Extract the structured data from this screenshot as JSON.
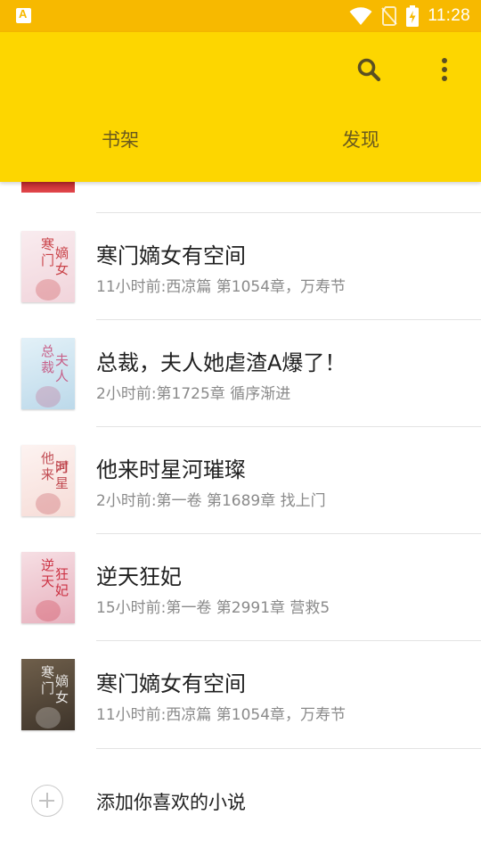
{
  "status_bar": {
    "time": "11:28",
    "icons": [
      "app-notification-icon",
      "wifi-icon",
      "no-sim-icon",
      "battery-charging-icon"
    ],
    "background": "#f7b900"
  },
  "app_bar": {
    "background": "#fdd600",
    "actions": [
      "search-icon",
      "more-vert-icon"
    ],
    "tabs": [
      {
        "label": "书架",
        "selected": true
      },
      {
        "label": "发现",
        "selected": false
      }
    ]
  },
  "books": [
    {
      "title": "寒门嫡女有空间",
      "subtitle": "11小时前:西凉篇 第1054章，万寿节",
      "cover_text": "寒门嫡女",
      "cover": [
        "#f9ecef",
        "#f1d4db"
      ],
      "cover_ink": "#c2272d"
    },
    {
      "title": "总裁，夫人她虐渣A爆了！",
      "subtitle": "2小时前:第1725章 循序渐进",
      "cover_text": "总裁夫人",
      "cover": [
        "#e3f1f8",
        "#bcd9ea"
      ],
      "cover_ink": "#c54a78"
    },
    {
      "title": "他来时星河璀璨",
      "subtitle": "2小时前:第一卷 第1689章 找上门",
      "cover_text": "他来时星河",
      "cover": [
        "#fdf3f1",
        "#f6dcd7"
      ],
      "cover_ink": "#b8313a"
    },
    {
      "title": "逆天狂妃",
      "subtitle": "15小时前:第一卷 第2991章 营救5",
      "cover_text": "逆天狂妃",
      "cover": [
        "#f6dfe4",
        "#e7b0bd"
      ],
      "cover_ink": "#c6182b"
    },
    {
      "title": "寒门嫡女有空间",
      "subtitle": "11小时前:西凉篇 第1054章，万寿节",
      "cover_text": "寒门嫡女",
      "cover": [
        "#6f5f4b",
        "#3e342a"
      ],
      "cover_ink": "#ffffff"
    }
  ],
  "add_row": {
    "label": "添加你喜欢的小说",
    "icon": "add-circle-icon"
  }
}
